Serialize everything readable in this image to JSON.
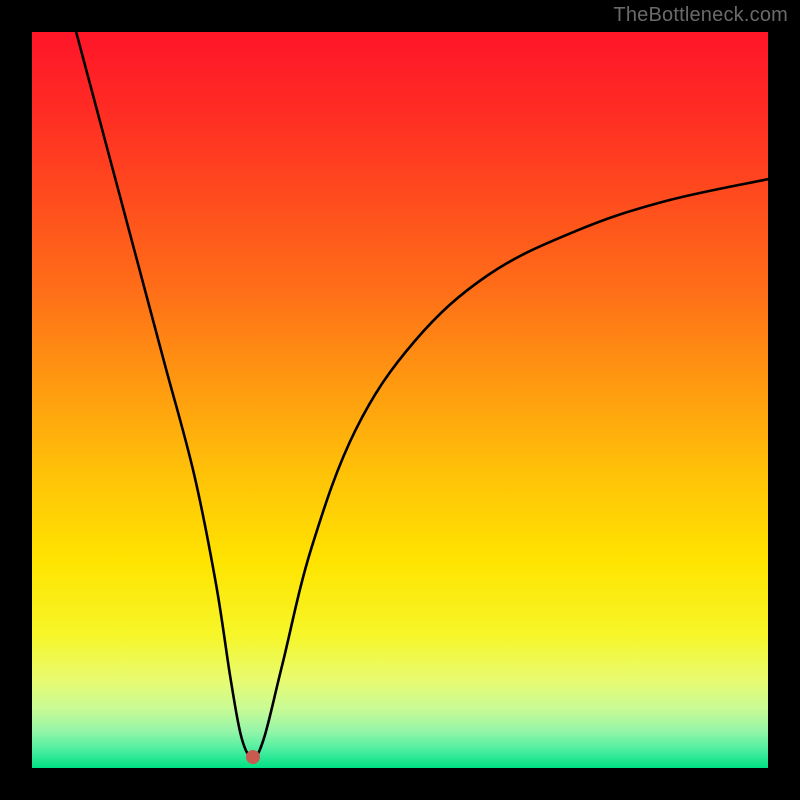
{
  "watermark": "TheBottleneck.com",
  "chart_data": {
    "type": "line",
    "title": "",
    "xlabel": "",
    "ylabel": "",
    "xlim": [
      0,
      100
    ],
    "ylim": [
      0,
      100
    ],
    "grid": false,
    "legend": false,
    "background_gradient": {
      "top_color": "#ff1a2a",
      "mid_color": "#ffe000",
      "bottom_color": "#00e676"
    },
    "marker": {
      "x": 30,
      "y": 1.5,
      "color": "#c85a4f"
    },
    "series": [
      {
        "name": "curve",
        "x": [
          6,
          10,
          14,
          18,
          22,
          25,
          27,
          28.5,
          30,
          31.5,
          34,
          38,
          44,
          52,
          62,
          74,
          86,
          100
        ],
        "y": [
          100,
          85,
          70,
          55,
          40,
          25,
          12,
          4,
          1.5,
          4,
          14,
          30,
          46,
          58,
          67,
          73,
          77,
          80
        ]
      }
    ]
  }
}
